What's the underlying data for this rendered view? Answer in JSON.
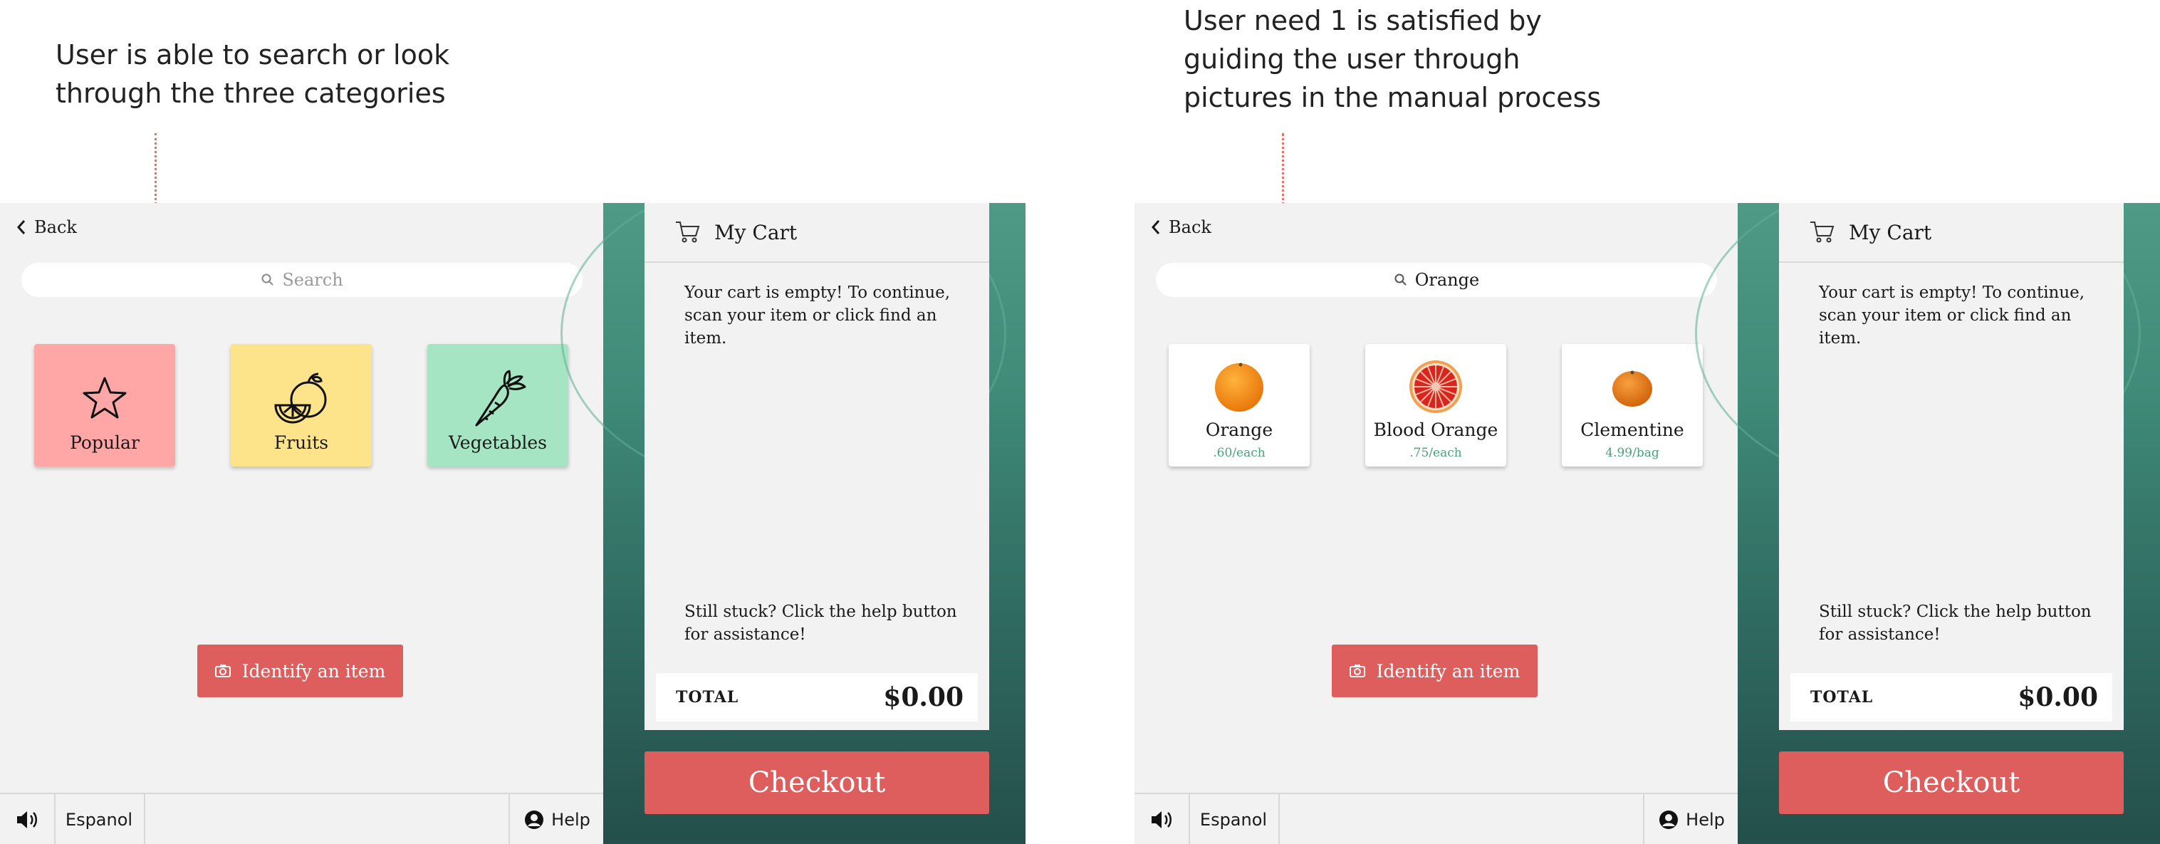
{
  "colors": {
    "accent_red": "#de5e5e",
    "popular_tile": "#ffa7a7",
    "fruits_tile": "#fde48b",
    "vegetables_tile": "#a6e5c3",
    "price_green": "#4ba27a"
  },
  "annotations": [
    "User is able to search or look\nthrough the three categories",
    "User need 1 is satisfied by\nguiding the user through\npictures in the manual process"
  ],
  "screen1": {
    "back_label": "Back",
    "search_placeholder": "Search",
    "categories": [
      {
        "label": "Popular",
        "icon": "star-icon"
      },
      {
        "label": "Fruits",
        "icon": "orange-slice-icon"
      },
      {
        "label": "Vegetables",
        "icon": "carrot-icon"
      }
    ],
    "identify_label": "Identify an item",
    "bottom": {
      "volume_icon": "speaker-icon",
      "language": "Espanol",
      "help": "Help",
      "help_icon": "user-circle-icon"
    },
    "cart": {
      "title": "My Cart",
      "empty_message": "Your cart is empty! To continue, scan your item or click find an item.",
      "help_message": "Still stuck? Click the help button for assistance!",
      "total_label": "TOTAL",
      "total_value": "$0.00",
      "checkout_label": "Checkout"
    }
  },
  "screen2": {
    "back_label": "Back",
    "search_value": "Orange",
    "products": [
      {
        "name": "Orange",
        "price": ".60/each",
        "icon": "orange-icon"
      },
      {
        "name": "Blood Orange",
        "price": ".75/each",
        "icon": "blood-orange-icon"
      },
      {
        "name": "Clementine",
        "price": "4.99/bag",
        "icon": "clementine-icon"
      }
    ],
    "identify_label": "Identify an item",
    "bottom": {
      "volume_icon": "speaker-icon",
      "language": "Espanol",
      "help": "Help",
      "help_icon": "user-circle-icon"
    },
    "cart": {
      "title": "My Cart",
      "empty_message": "Your cart is empty! To continue, scan your item or click find an item.",
      "help_message": "Still stuck? Click the help button for assistance!",
      "total_label": "TOTAL",
      "total_value": "$0.00",
      "checkout_label": "Checkout"
    }
  }
}
